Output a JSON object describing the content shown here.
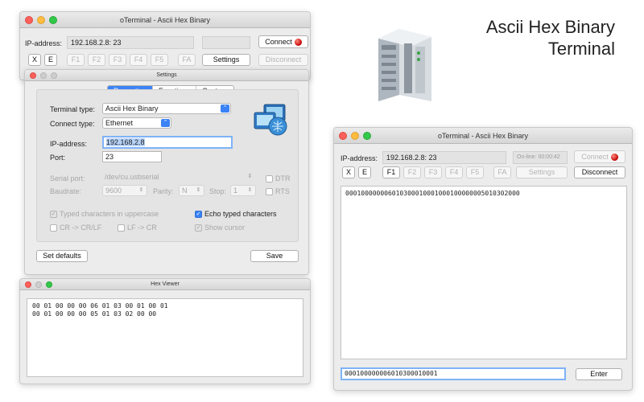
{
  "heading": {
    "line1": "Ascii Hex Binary",
    "line2": "Terminal"
  },
  "left_window": {
    "title": "oTerminal - Ascii Hex Binary",
    "ip_label": "IP-address:",
    "ip_value": "192.168.2.8: 23",
    "connect_label": "Connect",
    "buttons": {
      "x": "X",
      "e": "E",
      "f1": "F1",
      "f2": "F2",
      "f3": "F3",
      "f4": "F4",
      "f5": "F5",
      "fa": "FA",
      "settings": "Settings",
      "disconnect": "Disconnect"
    }
  },
  "settings": {
    "title": "Settings",
    "tabs": [
      "Properties",
      "Functions",
      "Capture"
    ],
    "terminal_type_label": "Terminal type:",
    "terminal_type_value": "Ascii Hex Binary",
    "connect_type_label": "Connect type:",
    "connect_type_value": "Ethernet",
    "ip_label": "IP-address:",
    "ip_value": "192.168.2.8",
    "port_label": "Port:",
    "port_value": "23",
    "serial_port_label": "Serial port:",
    "serial_port_value": "/dev/cu.usbserial",
    "dtr": "DTR",
    "baudrate_label": "Baudrate:",
    "baudrate_value": "9600",
    "parity_label": "Parity:",
    "parity_value": "N",
    "stop_label": "Stop:",
    "stop_value": "1",
    "rts": "RTS",
    "typed_upper": "Typed characters in uppercase",
    "echo_typed": "Echo typed characters",
    "cr_crlf": "CR -> CR/LF",
    "lf_cr": "LF -> CR",
    "show_cursor": "Show cursor",
    "set_defaults": "Set defaults",
    "save": "Save"
  },
  "hex_viewer": {
    "title": "Hex Viewer",
    "lines": [
      "00 01 00 00 00 06 01 03 00 01 00 01",
      "00 01 00 00 00 05 01 03 02 00 00"
    ]
  },
  "right_window": {
    "title": "oTerminal - Ascii Hex Binary",
    "ip_label": "IP-address:",
    "ip_value": "192.168.2.8: 23",
    "online_label": "On-line: 00:00:42",
    "connect_label": "Connect",
    "buttons": {
      "x": "X",
      "e": "E",
      "f1": "F1",
      "f2": "F2",
      "f3": "F3",
      "f4": "F4",
      "f5": "F5",
      "fa": "FA",
      "settings": "Settings",
      "disconnect": "Disconnect"
    },
    "output": "000100000006010300010001000100000005010302000",
    "input_value": "000100000006010300010001",
    "enter_label": "Enter"
  },
  "colors": {
    "accent": "#3b82f6",
    "led_red": "#c40000"
  },
  "icons": [
    "network-icon",
    "device-image",
    "led-icon",
    "chevron-icon"
  ]
}
